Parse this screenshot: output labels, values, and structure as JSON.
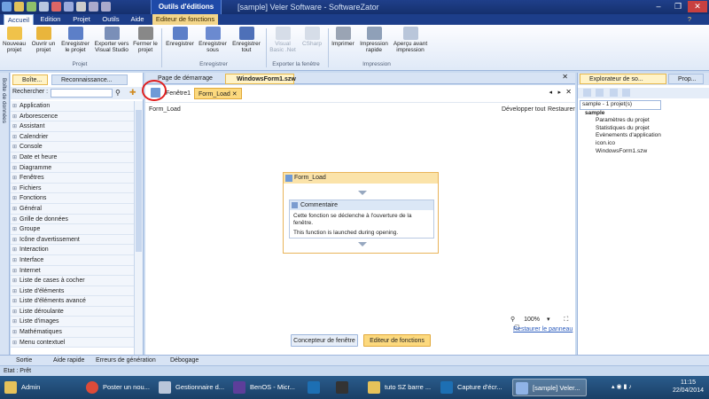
{
  "titlebar": {
    "context_tab": "Outils d'éditions",
    "app_title": "[sample] Veler Software - SoftwareZator",
    "help": "?",
    "minimize": "–",
    "maximize": "❐",
    "close": "✕"
  },
  "ribbon_tabs": [
    "Accueil",
    "Edition",
    "Projet",
    "Outils",
    "Aide",
    "Editeur de fonctions"
  ],
  "ribbon": {
    "buttons": [
      {
        "label": "Nouveau projet",
        "icon": "new-project-icon"
      },
      {
        "label": "Ouvrir un projet",
        "icon": "open-project-icon"
      },
      {
        "label": "Enregistrer le projet",
        "icon": "save-project-icon"
      },
      {
        "label": "Exporter vers Visual Studio",
        "icon": "visual-studio-icon"
      },
      {
        "label": "Fermer le projet",
        "icon": "close-project-icon"
      },
      {
        "label": "Enregistrer",
        "icon": "save-icon"
      },
      {
        "label": "Enregistrer sous",
        "icon": "save-as-icon"
      },
      {
        "label": "Enregistrer tout",
        "icon": "save-all-icon"
      },
      {
        "label": "Visual Basic .Net",
        "icon": "vb-icon"
      },
      {
        "label": "CSharp",
        "icon": "csharp-icon"
      },
      {
        "label": "Imprimer",
        "icon": "print-icon"
      },
      {
        "label": "Impression rapide",
        "icon": "quick-print-icon"
      },
      {
        "label": "Aperçu avant impression",
        "icon": "print-preview-icon"
      }
    ],
    "groups": [
      "Projet",
      "Enregistrer",
      "Exporter la fenêtre",
      "Impression"
    ]
  },
  "left_panel": {
    "strip_label": "Boîte de données",
    "tab_active": "Boîte...",
    "tab_inactive": "Reconnaissance...",
    "search_label": "Rechercher :",
    "search_placeholder": "",
    "items": [
      "Application",
      "Arborescence",
      "Assistant",
      "Calendrier",
      "Console",
      "Date et heure",
      "Diagramme",
      "Fenêtres",
      "Fichiers",
      "Fonctions",
      "Général",
      "Grille de données",
      "Groupe",
      "Icône d'avertissement",
      "Interaction",
      "Interface",
      "Internet",
      "Liste de cases à cocher",
      "Liste d'éléments",
      "Liste d'éléments avancé",
      "Liste déroulante",
      "Liste d'images",
      "Mathématiques",
      "Menu contextuel"
    ]
  },
  "doc_tabs": [
    "Page de démarrage",
    "WindowsForm1.szw"
  ],
  "doc_toolbar": {
    "crumb1": "Fenêtre1",
    "crumb2": "Form_Load"
  },
  "canvas": {
    "title": "Form_Load",
    "expand_all": "Développer tout",
    "restore": "Restaurer",
    "block_title": "Form_Load",
    "comment_title": "Commentaire",
    "comment_line1": "Cette fonction se déclenche à l'ouverture de la fenêtre.",
    "comment_line2": "This function is launched during opening.",
    "zoom": "100%",
    "restore_panel": "Restaurer le panneau",
    "btn_designer": "Concepteur de fenêtre",
    "btn_editor": "Editeur de fonctions"
  },
  "right_panel": {
    "tab1": "Explorateur de so...",
    "tab2": "Prop...",
    "tree": {
      "solution": "sample - 1 projet(s)",
      "project": "sample",
      "children": [
        "Paramètres du projet",
        "Statistiques du projet",
        "Evènements d'application",
        "icon.ico",
        "WindowsForm1.szw"
      ]
    }
  },
  "bottom_tabs": [
    "Sortie",
    "Aide rapide",
    "Erreurs de génération",
    "Débogage"
  ],
  "status": "Etat : Prêt",
  "taskbar": {
    "items": [
      "Admin",
      "Poster un nou...",
      "Gestionnaire d...",
      "BenOS - Micr...",
      "",
      "",
      "tuto SZ barre ...",
      "Capture d'écr...",
      "[sample] Veler..."
    ],
    "time": "11:15",
    "date": "22/04/2014"
  },
  "colors": {
    "accent": "#1f3f8a",
    "highlight": "#fcd97e"
  }
}
